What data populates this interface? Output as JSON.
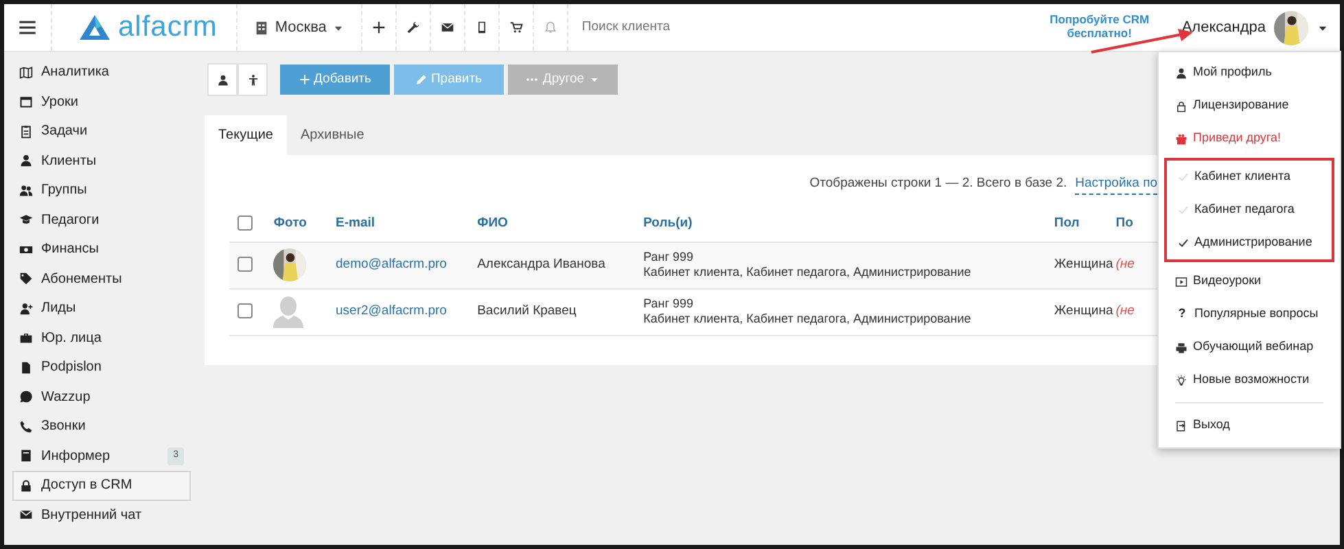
{
  "navbar": {
    "logo": "alfacrm",
    "branch": "Москва",
    "search": {
      "placeholder": "Поиск клиента"
    },
    "promo": "Попробуйте CRM бесплатно!",
    "user_name": "Александра"
  },
  "sidebar": {
    "items": [
      {
        "label": "Аналитика",
        "selected": false
      },
      {
        "label": "Уроки",
        "selected": false
      },
      {
        "label": "Задачи",
        "selected": false
      },
      {
        "label": "Клиенты",
        "selected": false
      },
      {
        "label": "Группы",
        "selected": false
      },
      {
        "label": "Педагоги",
        "selected": false
      },
      {
        "label": "Финансы",
        "selected": false
      },
      {
        "label": "Абонементы",
        "selected": false
      },
      {
        "label": "Лиды",
        "selected": false
      },
      {
        "label": "Юр. лица",
        "selected": false
      },
      {
        "label": "Podpislon",
        "selected": false
      },
      {
        "label": "Wazzup",
        "selected": false
      },
      {
        "label": "Звонки",
        "selected": false
      },
      {
        "label": "Информер",
        "selected": false,
        "badge": "3"
      },
      {
        "label": "Доступ в CRM",
        "selected": true
      },
      {
        "label": "Внутренний чат",
        "selected": false
      }
    ]
  },
  "toolbar": {
    "buttons": [
      {
        "kind": "primary",
        "label": "Добавить",
        "disabled": false
      },
      {
        "kind": "secondary",
        "label": "Править",
        "disabled": false
      },
      {
        "kind": "dropdown",
        "label": "Другое",
        "disabled": true
      }
    ]
  },
  "tabs": [
    {
      "label": "Текущие",
      "selected": true
    },
    {
      "label": "Архивные",
      "selected": false
    }
  ],
  "table": {
    "all_checked": false,
    "summary": "Отображены строки 1 — 2. Всего в базе 2.",
    "settings_link": "Настройка по",
    "columns": [
      "Фото",
      "E-mail",
      "ФИО",
      "Роль(и)",
      "Пол",
      "По"
    ],
    "rows": [
      {
        "checked": false,
        "email": "demo@alfacrm.pro",
        "name": "Александра Иванова",
        "rank": "Ранг 999",
        "roles": "Кабинет клиента, Кабинет педагога, Администрирование",
        "gender": "Женщина",
        "column_7": "(не"
      },
      {
        "checked": false,
        "avatar": {
          "kind": "silhouette"
        },
        "email": "user2@alfacrm.pro",
        "name": "Василий Кравец",
        "rank": "Ранг 999",
        "roles": "Кабинет клиента, Кабинет педагога, Администрирование",
        "gender": "Женщина",
        "column_7": "(не"
      }
    ]
  },
  "user_menu": {
    "sections": [
      {
        "items": [
          {
            "kind": "link",
            "label": "Мой профиль"
          },
          {
            "kind": "link",
            "label": "Лицензирование"
          },
          {
            "kind": "promo",
            "label": "Приведи друга!"
          }
        ]
      },
      {
        "highlighted": true,
        "items": [
          {
            "kind": "role",
            "label": "Кабинет клиента",
            "checked": false
          },
          {
            "kind": "role",
            "label": "Кабинет педагога",
            "checked": false
          },
          {
            "kind": "role",
            "label": "Администрирование",
            "checked": true
          }
        ]
      },
      {
        "items": [
          {
            "kind": "link",
            "label": "Видеоуроки"
          },
          {
            "kind": "link",
            "label": "Популярные вопросы",
            "icon_text": "?"
          },
          {
            "kind": "link",
            "label": "Обучающий вебинар"
          },
          {
            "kind": "link",
            "label": "Новые возможности"
          }
        ]
      },
      {
        "divider": true,
        "items": [
          {
            "kind": "link",
            "label": "Выход"
          }
        ]
      }
    ]
  }
}
